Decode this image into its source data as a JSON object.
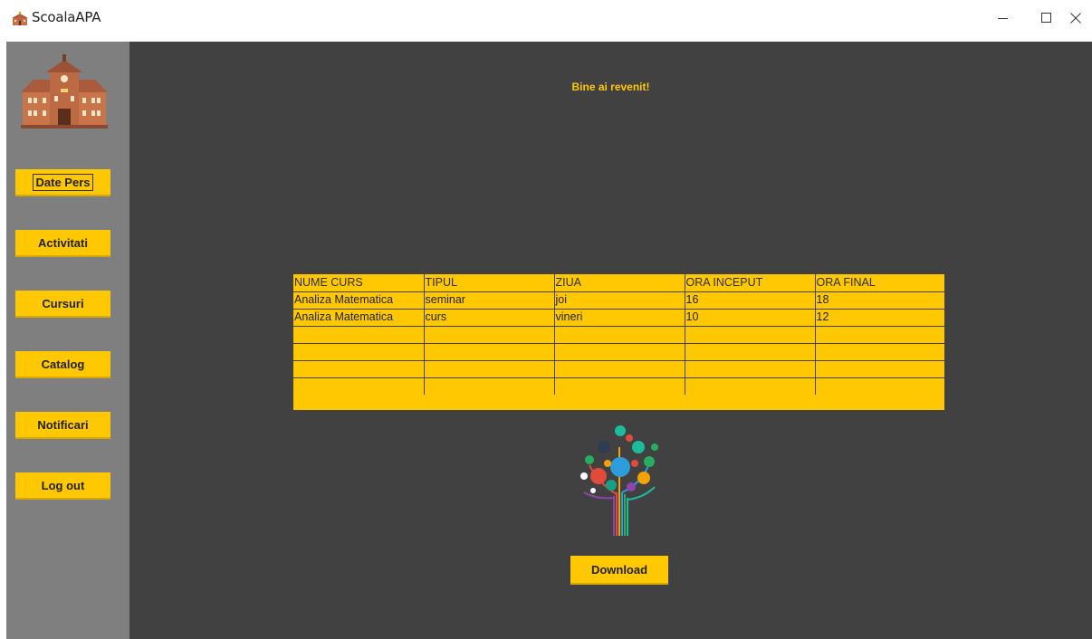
{
  "window": {
    "title": "ScoalaAPA"
  },
  "sidebar": {
    "items": [
      {
        "label": "Date Pers"
      },
      {
        "label": "Activitati"
      },
      {
        "label": "Cursuri"
      },
      {
        "label": "Catalog"
      },
      {
        "label": "Notificari"
      },
      {
        "label": "Log out"
      }
    ]
  },
  "main": {
    "welcome": "Bine ai revenit!",
    "table": {
      "columns": [
        "NUME CURS",
        "TIPUL",
        "ZIUA",
        "ORA INCEPUT",
        "ORA FINAL"
      ],
      "rows": [
        [
          "Analiza Matematica",
          "seminar",
          "joi",
          "16",
          "18"
        ],
        [
          "Analiza Matematica",
          "curs",
          "vineri",
          "10",
          "12"
        ],
        [
          "",
          "",
          "",
          "",
          ""
        ],
        [
          "",
          "",
          "",
          "",
          ""
        ],
        [
          "",
          "",
          "",
          "",
          ""
        ],
        [
          "",
          "",
          "",
          "",
          ""
        ]
      ]
    },
    "download_label": "Download"
  },
  "colors": {
    "accent": "#ffc800",
    "sidebar_bg": "#7f7f7f",
    "main_bg": "#414141"
  }
}
